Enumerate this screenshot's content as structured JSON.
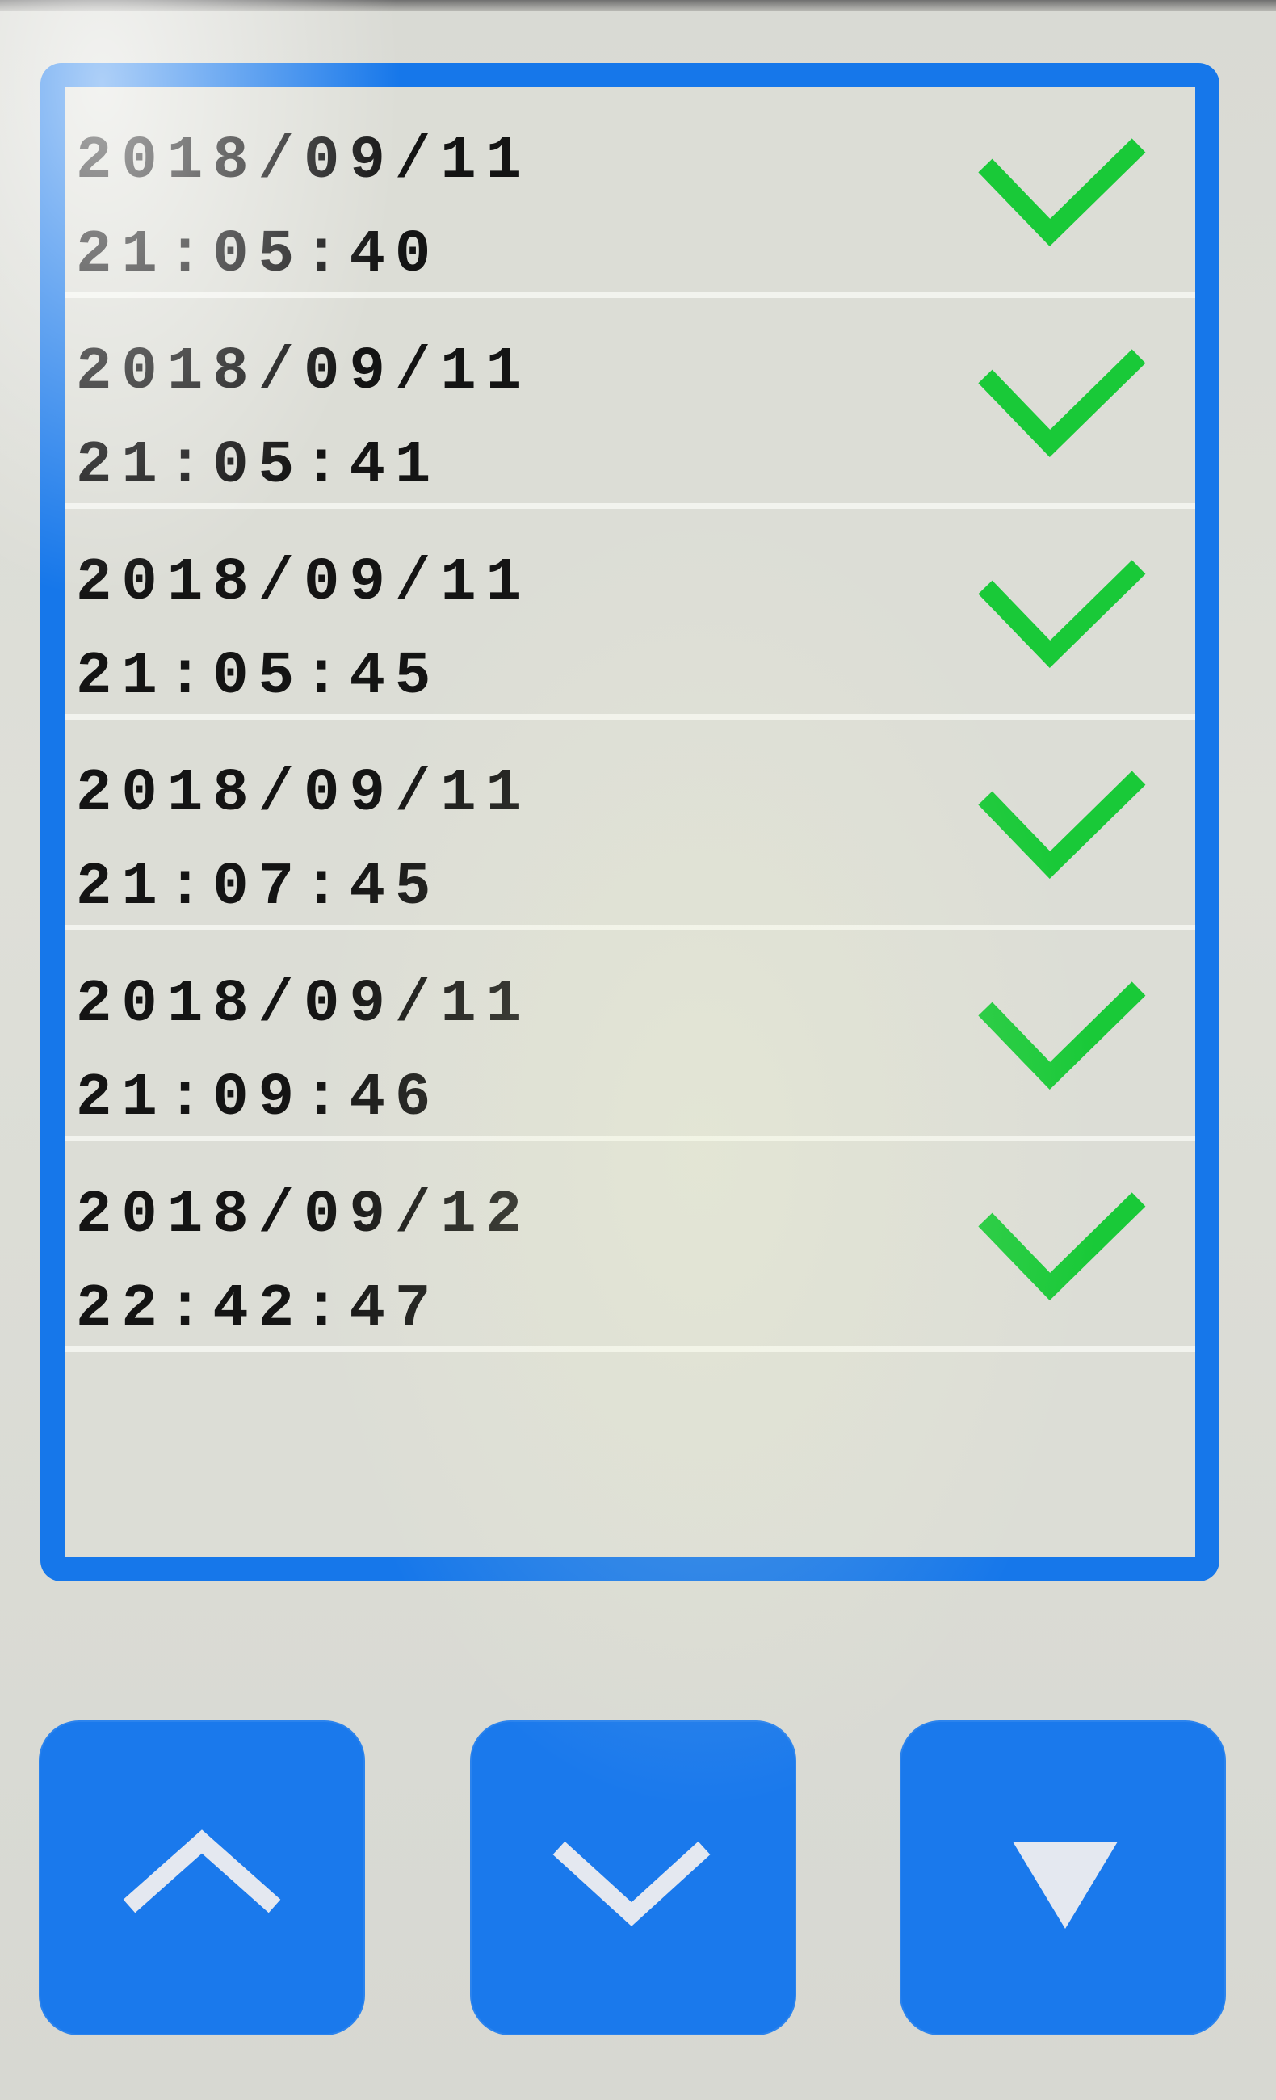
{
  "records": [
    {
      "date": "2018/09/11",
      "time": "21:05:40",
      "status_icon": "check-icon",
      "status_color": "#19c938"
    },
    {
      "date": "2018/09/11",
      "time": "21:05:41",
      "status_icon": "check-icon",
      "status_color": "#19c938"
    },
    {
      "date": "2018/09/11",
      "time": "21:05:45",
      "status_icon": "check-icon",
      "status_color": "#19c938"
    },
    {
      "date": "2018/09/11",
      "time": "21:07:45",
      "status_icon": "check-icon",
      "status_color": "#19c938"
    },
    {
      "date": "2018/09/11",
      "time": "21:09:46",
      "status_icon": "check-icon",
      "status_color": "#19c938"
    },
    {
      "date": "2018/09/12",
      "time": "22:42:47",
      "status_icon": "check-icon",
      "status_color": "#19c938"
    }
  ],
  "controls": {
    "scroll_up": {
      "icon": "chevron-up-icon"
    },
    "scroll_down": {
      "icon": "chevron-down-icon"
    },
    "page_end": {
      "icon": "triangle-down-icon"
    }
  },
  "colors": {
    "accent": "#1677ea",
    "panel_background": "#dcddd6",
    "row_divider": "#f2f3ee",
    "text": "#141414",
    "button_icon": "#e4e8f0"
  }
}
